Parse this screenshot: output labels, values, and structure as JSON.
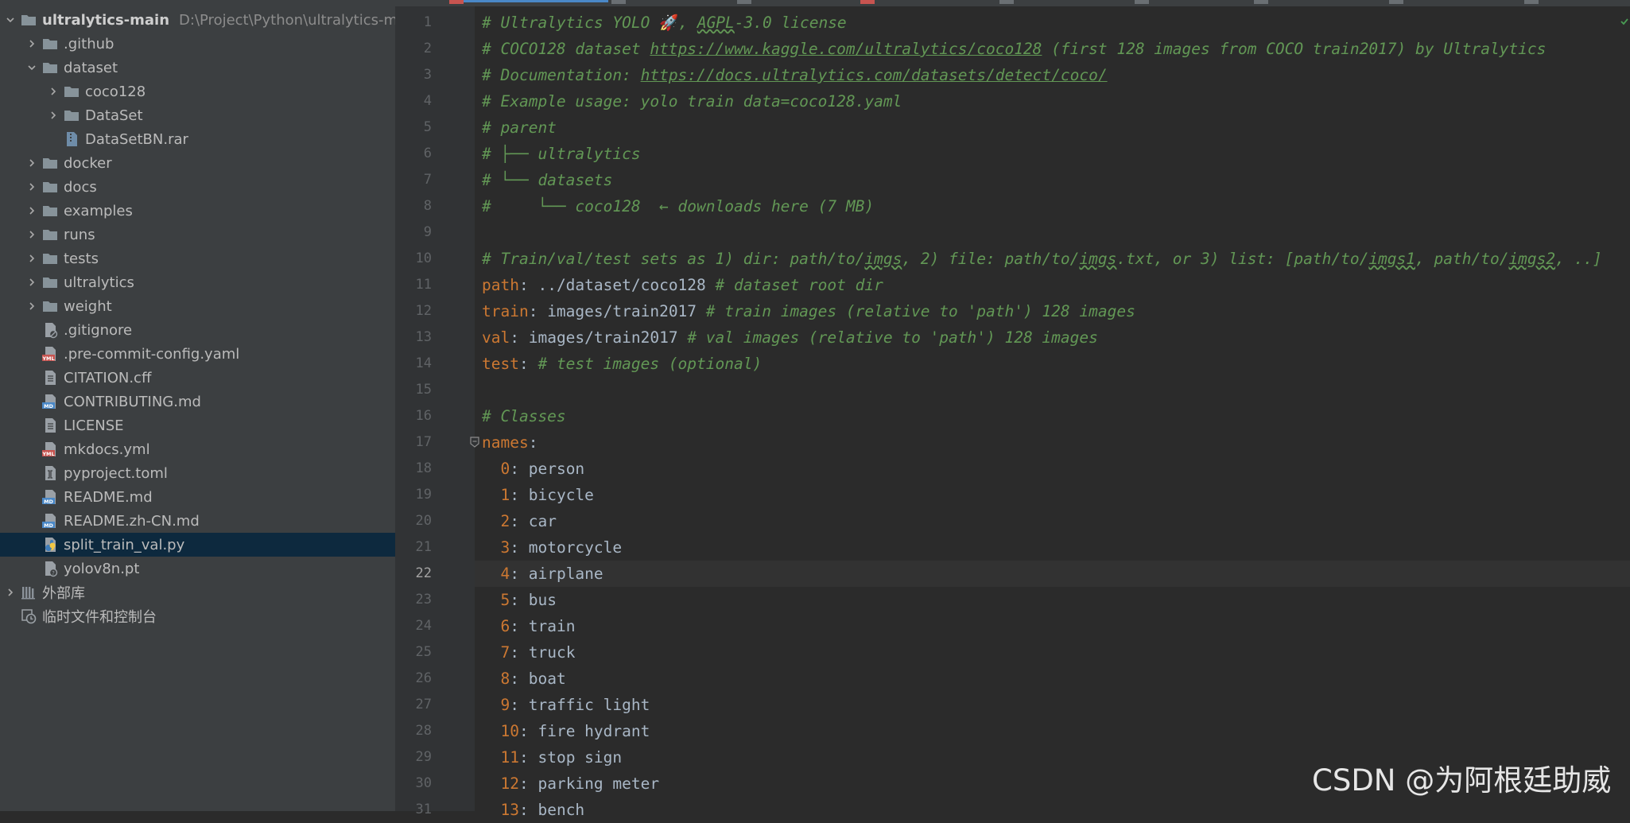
{
  "project": {
    "root": {
      "label": "ultralytics-main",
      "path": "D:\\Project\\Python\\ultralytics-main"
    },
    "items": [
      {
        "label": ".github",
        "type": "folder",
        "depth": 1,
        "expanded": false
      },
      {
        "label": "dataset",
        "type": "folder",
        "depth": 1,
        "expanded": true
      },
      {
        "label": "coco128",
        "type": "folder",
        "depth": 2,
        "expanded": false
      },
      {
        "label": "DataSet",
        "type": "folder",
        "depth": 2,
        "expanded": false
      },
      {
        "label": "DataSetBN.rar",
        "type": "file-archive",
        "depth": 2
      },
      {
        "label": "docker",
        "type": "folder",
        "depth": 1,
        "expanded": false
      },
      {
        "label": "docs",
        "type": "folder",
        "depth": 1,
        "expanded": false
      },
      {
        "label": "examples",
        "type": "folder",
        "depth": 1,
        "expanded": false
      },
      {
        "label": "runs",
        "type": "folder",
        "depth": 1,
        "expanded": false
      },
      {
        "label": "tests",
        "type": "folder",
        "depth": 1,
        "expanded": false
      },
      {
        "label": "ultralytics",
        "type": "folder",
        "depth": 1,
        "expanded": false
      },
      {
        "label": "weight",
        "type": "folder",
        "depth": 1,
        "expanded": false
      },
      {
        "label": ".gitignore",
        "type": "file-ignored",
        "depth": 1
      },
      {
        "label": ".pre-commit-config.yaml",
        "type": "file-yaml",
        "depth": 1
      },
      {
        "label": "CITATION.cff",
        "type": "file-text",
        "depth": 1
      },
      {
        "label": "CONTRIBUTING.md",
        "type": "file-md",
        "depth": 1
      },
      {
        "label": "LICENSE",
        "type": "file-text",
        "depth": 1
      },
      {
        "label": "mkdocs.yml",
        "type": "file-yaml",
        "depth": 1
      },
      {
        "label": "pyproject.toml",
        "type": "file-toml",
        "depth": 1
      },
      {
        "label": "README.md",
        "type": "file-md",
        "depth": 1
      },
      {
        "label": "README.zh-CN.md",
        "type": "file-md",
        "depth": 1
      },
      {
        "label": "split_train_val.py",
        "type": "file-python",
        "depth": 1,
        "selected": true
      },
      {
        "label": "yolov8n.pt",
        "type": "file-unknown",
        "depth": 1
      }
    ],
    "external_libraries": "外部库",
    "scratches": "临时文件和控制台"
  },
  "editor": {
    "current_line": 22,
    "line_numbers": [
      "1",
      "2",
      "3",
      "4",
      "5",
      "6",
      "7",
      "8",
      "9",
      "10",
      "11",
      "12",
      "13",
      "14",
      "15",
      "16",
      "17",
      "18",
      "19",
      "20",
      "21",
      "22",
      "23",
      "24",
      "25",
      "26",
      "27",
      "28",
      "29",
      "30",
      "31"
    ],
    "comments": {
      "l1a": "# Ultralytics YOLO ",
      "rocket": "🚀",
      "l1b": ", ",
      "l1c": "AGPL",
      "l1d": "-3.0 license",
      "l2a": "# COCO128 dataset ",
      "l2b": "https://www.kaggle.com/ultralytics/coco128",
      "l2c": " (first 128 images from COCO train2017) by Ultralytics",
      "l3a": "# Documentation: ",
      "l3b": "https://docs.ultralytics.com/datasets/detect/coco/",
      "l4": "# Example usage: yolo train data=coco128.yaml",
      "l5": "# parent",
      "l6": "# ├── ultralytics",
      "l7": "# └── datasets",
      "l8": "#     └── coco128  ← downloads here (7 MB)",
      "l10a": "# Train/val/test sets as 1) dir: path/to/",
      "l10b": "imgs",
      "l10c": ", 2) file: path/to/",
      "l10d": "imgs",
      "l10e": ".txt, or 3) list: [path/to/",
      "l10f": "imgs1",
      "l10g": ", path/to/",
      "l10h": "imgs2",
      "l10i": ", ..]",
      "l16": "# Classes"
    },
    "config": {
      "path_key": "path",
      "path_val": " ../dataset/coco128 ",
      "path_comment": "# dataset root dir",
      "train_key": "train",
      "train_val": " images/train2017 ",
      "train_comment": "# train images (relative to 'path') 128 images",
      "val_key": "val",
      "val_val": " images/train2017 ",
      "val_comment": "# val images (relative to 'path') 128 images",
      "test_key": "test",
      "test_comment": " # test images (optional)",
      "names_key": "names",
      "colon": ":"
    },
    "classes": [
      {
        "id": "0",
        "name": "person"
      },
      {
        "id": "1",
        "name": "bicycle"
      },
      {
        "id": "2",
        "name": "car"
      },
      {
        "id": "3",
        "name": "motorcycle"
      },
      {
        "id": "4",
        "name": "airplane"
      },
      {
        "id": "5",
        "name": "bus"
      },
      {
        "id": "6",
        "name": "train"
      },
      {
        "id": "7",
        "name": "truck"
      },
      {
        "id": "8",
        "name": "boat"
      },
      {
        "id": "9",
        "name": "traffic light"
      },
      {
        "id": "10",
        "name": "fire hydrant"
      },
      {
        "id": "11",
        "name": "stop sign"
      },
      {
        "id": "12",
        "name": "parking meter"
      },
      {
        "id": "13",
        "name": "bench"
      }
    ]
  },
  "watermark": "CSDN @为阿根廷助威",
  "colors": {
    "comment": "#629755",
    "keyword": "#cc7832",
    "text": "#a9b7c6",
    "selection": "#0d293e"
  }
}
